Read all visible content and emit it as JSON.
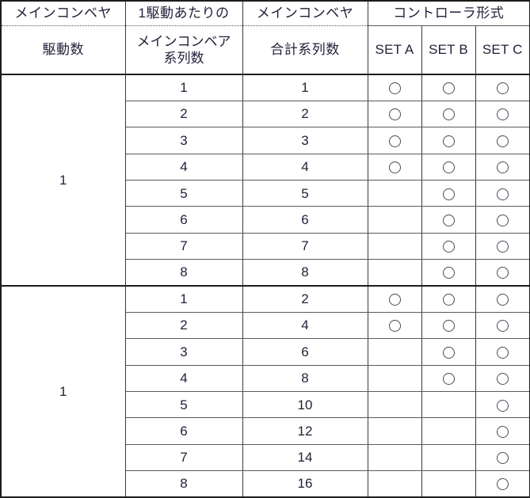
{
  "table": {
    "header": {
      "row1": [
        {
          "label": "メインコンベヤ",
          "span_note": "drive-count-top"
        },
        {
          "label": "1駆動あたりの",
          "span_note": "series-per-drive-top"
        },
        {
          "label": "メインコンベヤ",
          "span_note": "total-series-top"
        },
        {
          "label": "コントローラ形式",
          "span_note": "controller-type-group"
        }
      ],
      "row2": [
        {
          "label": "駆動数"
        },
        {
          "label_line1": "メインコンベア",
          "label_line2": "系列数"
        },
        {
          "label": "合計系列数"
        },
        {
          "label": "SET A"
        },
        {
          "label": "SET B"
        },
        {
          "label": "SET C"
        }
      ]
    },
    "columns": [
      "メインコンベヤ駆動数",
      "1駆動あたりのメインコンベア系列数",
      "メインコンベヤ合計系列数",
      "SET A",
      "SET B",
      "SET C"
    ],
    "marks": {
      "present": "○",
      "absent": ""
    },
    "blocks": [
      {
        "drive_count": "1",
        "rows": [
          {
            "series": "1",
            "total": "1",
            "set_a": "○",
            "set_b": "○",
            "set_c": "○"
          },
          {
            "series": "2",
            "total": "2",
            "set_a": "○",
            "set_b": "○",
            "set_c": "○"
          },
          {
            "series": "3",
            "total": "3",
            "set_a": "○",
            "set_b": "○",
            "set_c": "○"
          },
          {
            "series": "4",
            "total": "4",
            "set_a": "○",
            "set_b": "○",
            "set_c": "○"
          },
          {
            "series": "5",
            "total": "5",
            "set_a": "",
            "set_b": "○",
            "set_c": "○"
          },
          {
            "series": "6",
            "total": "6",
            "set_a": "",
            "set_b": "○",
            "set_c": "○"
          },
          {
            "series": "7",
            "total": "7",
            "set_a": "",
            "set_b": "○",
            "set_c": "○"
          },
          {
            "series": "8",
            "total": "8",
            "set_a": "",
            "set_b": "○",
            "set_c": "○"
          }
        ]
      },
      {
        "drive_count": "1",
        "rows": [
          {
            "series": "1",
            "total": "2",
            "set_a": "○",
            "set_b": "○",
            "set_c": "○"
          },
          {
            "series": "2",
            "total": "4",
            "set_a": "○",
            "set_b": "○",
            "set_c": "○"
          },
          {
            "series": "3",
            "total": "6",
            "set_a": "",
            "set_b": "○",
            "set_c": "○"
          },
          {
            "series": "4",
            "total": "8",
            "set_a": "",
            "set_b": "○",
            "set_c": "○"
          },
          {
            "series": "5",
            "total": "10",
            "set_a": "",
            "set_b": "",
            "set_c": "○"
          },
          {
            "series": "6",
            "total": "12",
            "set_a": "",
            "set_b": "",
            "set_c": "○"
          },
          {
            "series": "7",
            "total": "14",
            "set_a": "",
            "set_b": "",
            "set_c": "○"
          },
          {
            "series": "8",
            "total": "16",
            "set_a": "",
            "set_b": "",
            "set_c": "○"
          }
        ]
      }
    ]
  },
  "colors": {
    "frame": "#1c1c1c",
    "rule": "#5a5a5a",
    "text": "#22223b",
    "mark": "#4a4a5a",
    "background": "#ffffff"
  }
}
